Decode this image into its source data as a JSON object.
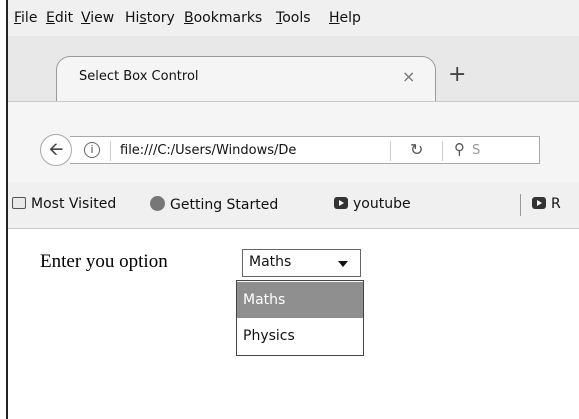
{
  "menu": [
    {
      "pre": "",
      "accel": "F",
      "post": "ile"
    },
    {
      "pre": "",
      "accel": "E",
      "post": "dit"
    },
    {
      "pre": "",
      "accel": "V",
      "post": "iew"
    },
    {
      "pre": "Hi",
      "accel": "s",
      "post": "tory"
    },
    {
      "pre": "",
      "accel": "B",
      "post": "ookmarks"
    },
    {
      "pre": "",
      "accel": "T",
      "post": "ools"
    },
    {
      "pre": "",
      "accel": "H",
      "post": "elp"
    }
  ],
  "tab": {
    "title": "Select Box Control",
    "close": "×"
  },
  "new_tab": "+",
  "nav": {
    "url": "file:///C:/Users/Windows/De",
    "search_placeholder": "S"
  },
  "bookmarks": [
    {
      "label": "Most Visited"
    },
    {
      "label": "Getting Started"
    },
    {
      "label": "youtube"
    },
    {
      "label": "R"
    }
  ],
  "page": {
    "prompt": "Enter you option",
    "select_value": "Maths",
    "options": [
      "Maths",
      "Physics"
    ],
    "highlighted_option": "Maths"
  }
}
